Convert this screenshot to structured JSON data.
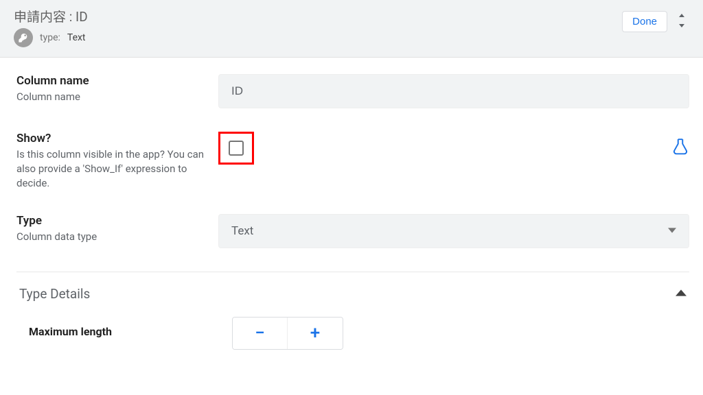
{
  "header": {
    "title_prefix": "申請内容",
    "title_sep": " : ",
    "title_value": "ID",
    "type_label": "type:",
    "type_value": "Text",
    "done_label": "Done"
  },
  "fields": {
    "column_name": {
      "label": "Column name",
      "desc": "Column name",
      "value": "ID"
    },
    "show": {
      "label": "Show?",
      "desc": "Is this column visible in the app? You can also provide a 'Show_If' expression to decide.",
      "checked": false
    },
    "type": {
      "label": "Type",
      "desc": "Column data type",
      "value": "Text"
    }
  },
  "section": {
    "type_details": "Type Details",
    "max_length_label": "Maximum length"
  },
  "icons": {
    "key": "key-icon",
    "expand": "expand-icon",
    "flask": "flask-icon",
    "dropdown": "chevron-down-icon",
    "chevron_up": "chevron-up-icon",
    "minus": "−",
    "plus": "+"
  }
}
